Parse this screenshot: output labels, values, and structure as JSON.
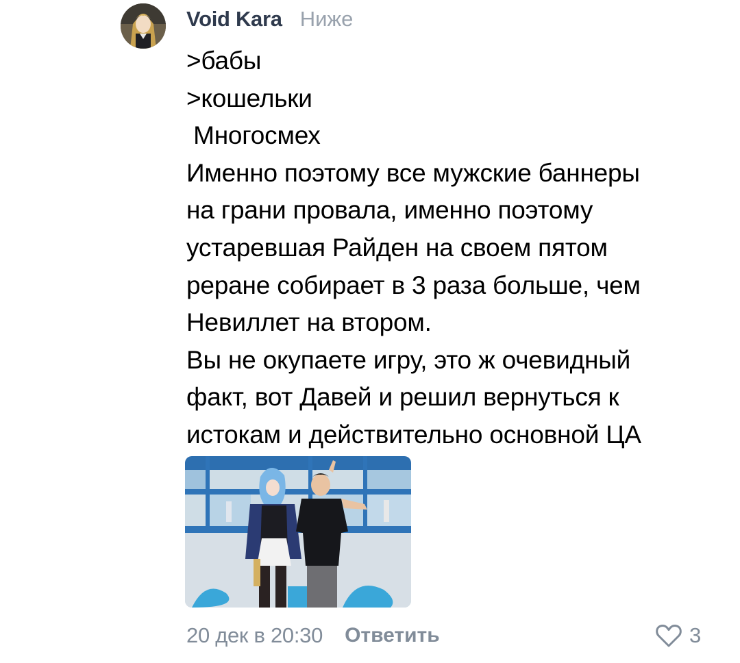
{
  "comment": {
    "author": {
      "name": "Void Kara",
      "status": "Ниже"
    },
    "text_lines": [
      ">бабы",
      ">кошельки",
      " Многосмех",
      "Именно поэтому все мужские баннеры",
      "на грани провала, именно поэтому",
      "устаревшая Райден на своем пятом",
      "реране собирает в 3 раза больше, чем",
      "Невиллет на втором.",
      "Вы не окупаете игру, это ж очевидный",
      "факт, вот Давей и решил вернуться к",
      "истокам и действительно основной ЦА"
    ],
    "attachment": {
      "type": "photo"
    },
    "footer": {
      "timestamp": "20 дек в 20:30",
      "reply_label": "Ответить",
      "likes_count": "3"
    }
  },
  "colors": {
    "author_name": "#2f3a4d",
    "secondary_text": "#818c99",
    "status_text": "#99a2ad",
    "body_text": "#000000",
    "background": "#ffffff"
  },
  "icons": {
    "like": "heart-outline-icon",
    "avatar": "user-avatar"
  }
}
